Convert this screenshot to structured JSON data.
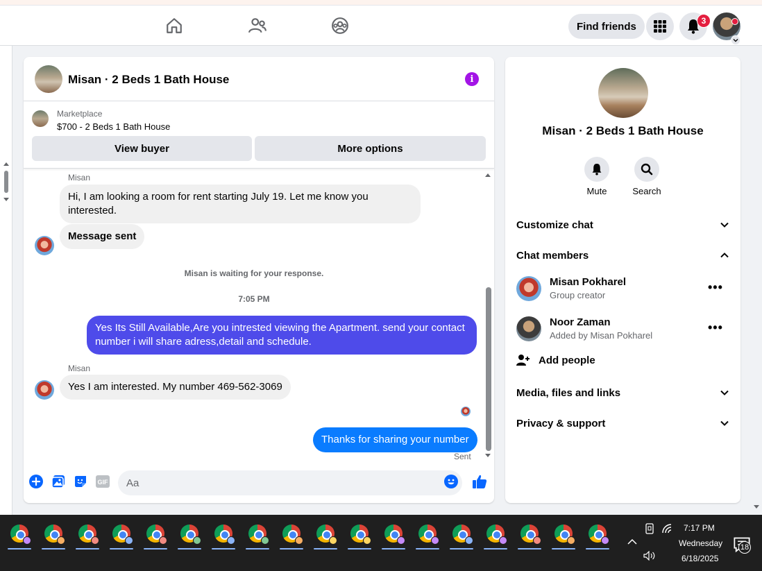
{
  "topnav": {
    "icons": [
      "home-icon",
      "friends-icon",
      "groups-icon"
    ],
    "find_friends_label": "Find friends",
    "notification_count": "3"
  },
  "chat": {
    "title": "Misan · 2 Beds 1 Bath House",
    "marketplace_label": "Marketplace",
    "listing": "$700 - 2 Beds 1 Bath House",
    "view_buyer_label": "View buyer",
    "more_options_label": "More options",
    "messages": [
      {
        "sender": "Misan",
        "text": "Hi, I am looking a room for rent starting July 19. Let me know you interested.",
        "direction": "in"
      },
      {
        "text": "Message sent",
        "direction": "in"
      },
      {
        "text": "Misan is waiting for your response.",
        "direction": "note"
      },
      {
        "text": "7:05 PM",
        "direction": "timestamp"
      },
      {
        "text": "Yes Its Still Available,Are you intrested viewing the Apartment. send your contact number i will share adress,detail and schedule.",
        "direction": "out"
      },
      {
        "sender": "Misan",
        "text": "Yes I am interested. My number 469-562-3069",
        "direction": "in"
      },
      {
        "text": "Thanks for sharing your number",
        "direction": "out"
      }
    ],
    "sent_status": "Sent",
    "composer_placeholder": "Aa"
  },
  "sidebar": {
    "title": "Misan · 2 Beds 1 Bath House",
    "actions": [
      {
        "label": "Mute",
        "icon": "bell-icon"
      },
      {
        "label": "Search",
        "icon": "search-icon"
      }
    ],
    "sections": {
      "customize_chat": "Customize chat",
      "chat_members": "Chat members",
      "media": "Media, files and links",
      "privacy": "Privacy & support"
    },
    "members": [
      {
        "name": "Misan Pokharel",
        "role": "Group creator"
      },
      {
        "name": "Noor Zaman",
        "role": "Added by Misan Pokharel"
      }
    ],
    "add_people_label": "Add people"
  },
  "taskbar": {
    "time": "7:17 PM",
    "day": "Wednesday",
    "date": "6/18/2025",
    "notification_count": "18",
    "app_count": 18
  },
  "colors": {
    "outgoing_primary": "#4e4bea",
    "outgoing_secondary": "#0a7cff",
    "accent": "#0866ff",
    "info": "#a314e6"
  }
}
